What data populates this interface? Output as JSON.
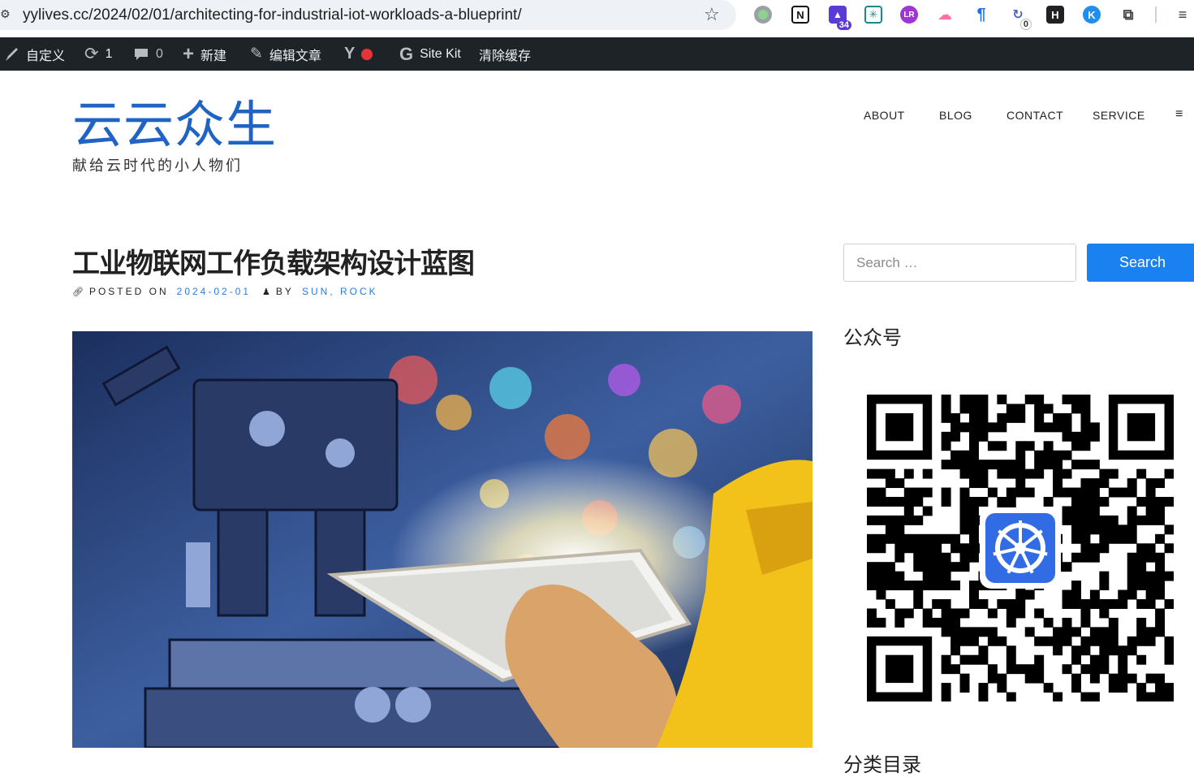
{
  "browser": {
    "url": "yylives.cc/2024/02/01/architecting-for-industrial-iot-workloads-a-blueprint/",
    "extensions": [
      {
        "name": "green-circle-extension-icon",
        "color": "#9aa0a6"
      },
      {
        "name": "notion-extension-icon",
        "label": "N",
        "color": "#111111"
      },
      {
        "name": "graduation-cap-extension-icon",
        "badge": "34",
        "color": "#5b3bd6"
      },
      {
        "name": "perplexity-extension-icon",
        "color": "#1b8a8f"
      },
      {
        "name": "lr-extension-icon",
        "label": "LR",
        "color": "#a234d6"
      },
      {
        "name": "cloud-face-extension-icon",
        "color": "#ff6fa8"
      },
      {
        "name": "blue-hook-extension-icon",
        "color": "#1a73e8"
      },
      {
        "name": "sync-extension-icon",
        "badge": "0",
        "color": "#4a63c8"
      },
      {
        "name": "h-square-extension-icon",
        "label": "H",
        "color": "#202124"
      },
      {
        "name": "globe-k-extension-icon",
        "label": "K",
        "color": "#1f8ef1"
      },
      {
        "name": "puzzle-extension-icon",
        "color": "#444444"
      }
    ]
  },
  "admin_bar": {
    "customize": "自定义",
    "updates_count": "1",
    "comments_count": "0",
    "new": "新建",
    "edit_post": "编辑文章",
    "site_kit": "Site Kit",
    "clear_cache": "清除缓存"
  },
  "site": {
    "title": "云云众生",
    "tagline": "献给云时代的小人物们",
    "accent": "#1f63c4"
  },
  "nav": {
    "items": [
      "ABOUT",
      "BLOG",
      "CONTACT",
      "SERVICE"
    ],
    "menu_toggle": "≡"
  },
  "post": {
    "title": "工业物联网工作负载架构设计蓝图",
    "posted_on_label": "POSTED ON",
    "date": "2024-02-01",
    "by_label": "BY",
    "author": "SUN, ROCK"
  },
  "sidebar": {
    "search_placeholder": "Search …",
    "search_button": "Search",
    "widget1_title": "公众号",
    "widget2_title": "分类目录",
    "button_color": "#1a82f0"
  }
}
